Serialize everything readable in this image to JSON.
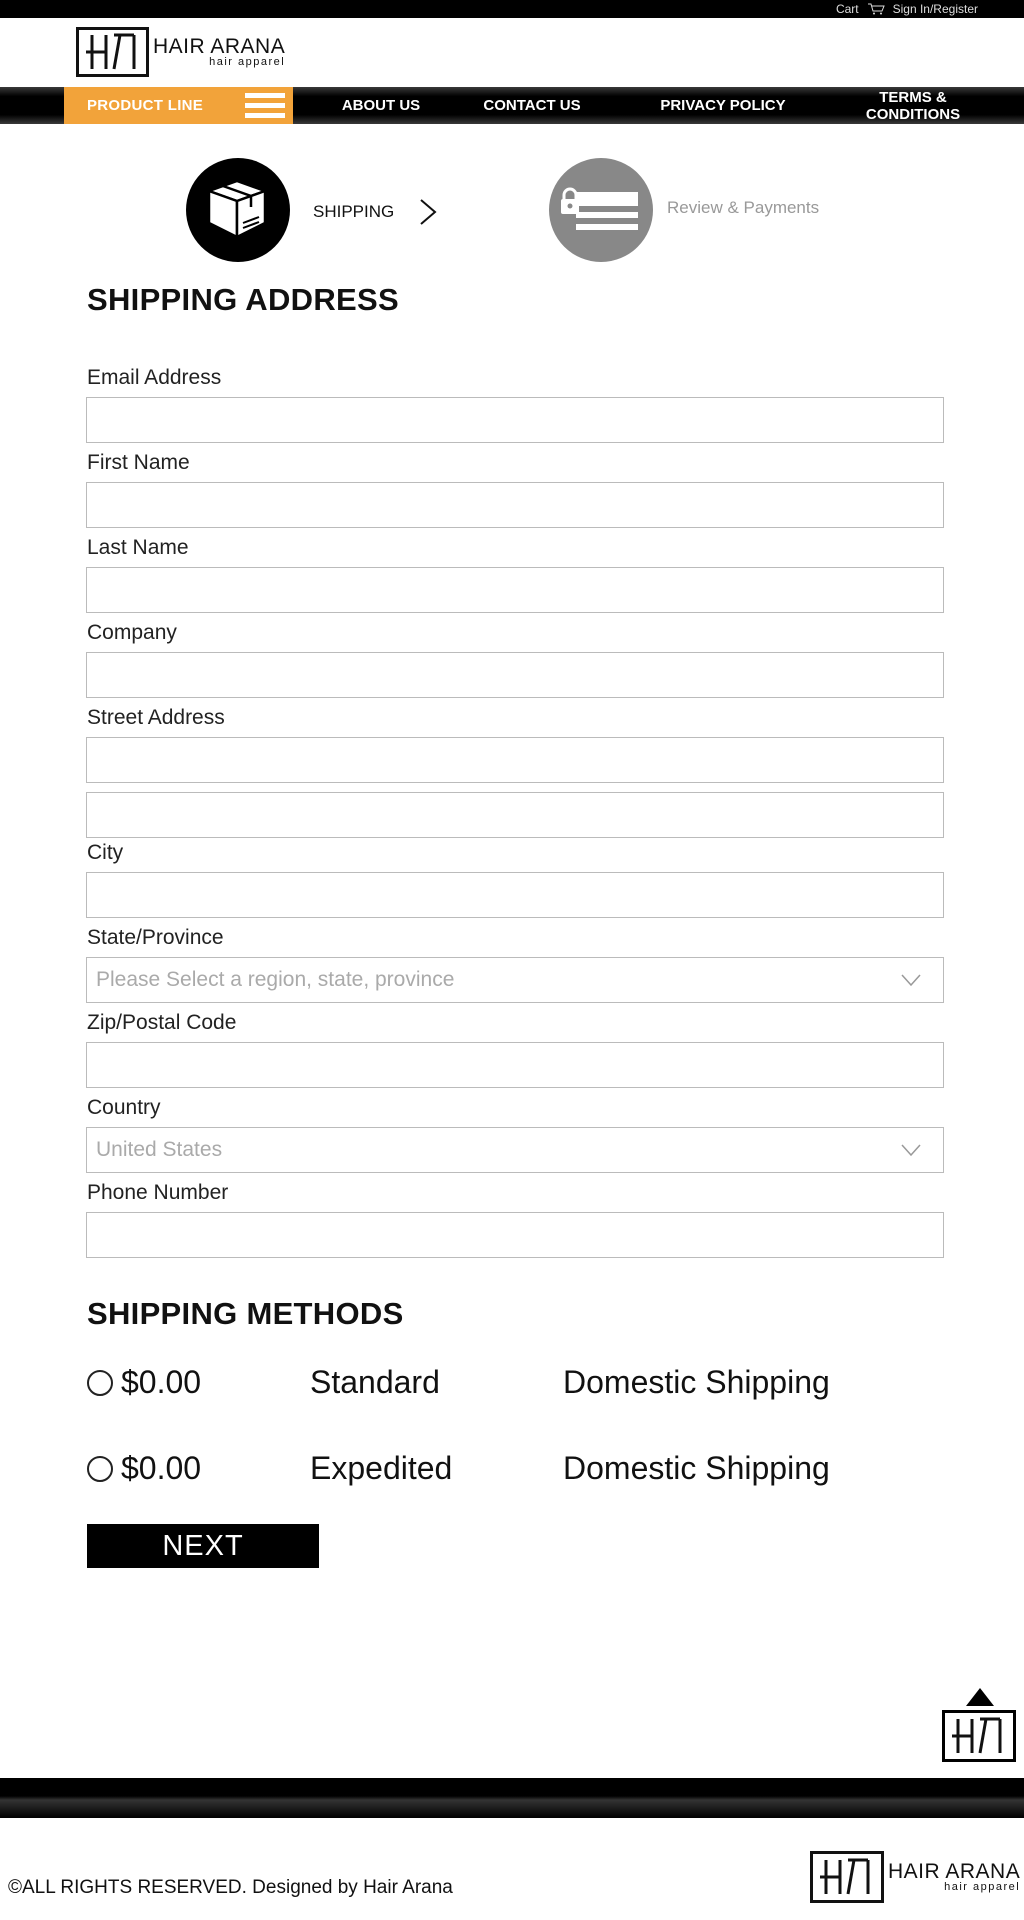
{
  "topbar": {
    "cart_label": "Cart",
    "signin_label": "Sign In/Register"
  },
  "brand": {
    "name": "HAIR ARANA",
    "tagline": "hair apparel"
  },
  "nav": {
    "product_line": "PRODUCT LINE",
    "items": [
      "ABOUT US",
      "CONTACT US",
      "PRIVACY POLICY",
      "TERMS & CONDITIONS"
    ]
  },
  "steps": {
    "step1": "SHIPPING",
    "step2": "Review & Payments"
  },
  "form": {
    "title": "SHIPPING ADDRESS",
    "email_label": "Email Address",
    "first_name_label": "First Name",
    "last_name_label": "Last Name",
    "company_label": "Company",
    "street_label": "Street Address",
    "city_label": "City",
    "state_label": "State/Province",
    "state_placeholder": "Please Select a region, state, province",
    "zip_label": "Zip/Postal Code",
    "country_label": "Country",
    "country_value": "United States",
    "phone_label": "Phone Number"
  },
  "methods": {
    "title": "SHIPPING METHODS",
    "options": [
      {
        "price": "$0.00",
        "name": "Standard",
        "desc": "Domestic Shipping"
      },
      {
        "price": "$0.00",
        "name": "Expedited",
        "desc": "Domestic Shipping"
      }
    ],
    "next_label": "NEXT"
  },
  "footer": {
    "copyright": "©ALL RIGHTS RESERVED. Designed by Hair Arana"
  },
  "colors": {
    "accent": "#f2a33a",
    "dark": "#000000",
    "step_inactive": "#888888"
  }
}
